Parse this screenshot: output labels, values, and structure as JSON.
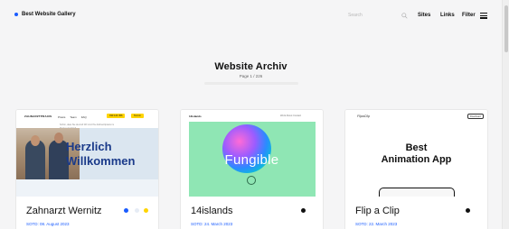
{
  "header": {
    "brand": "Best Website Gallery",
    "search_placeholder": "Search",
    "nav": [
      "Sites",
      "Links",
      "Filter"
    ]
  },
  "main": {
    "title": "Website Archiv",
    "pager": "Page 1 / 226"
  },
  "cards": [
    {
      "title": "Zahnarzt Wernitz",
      "date": "SOTD: 08. August 2023",
      "colors": [
        "#1a5cff",
        "#e6ecf5",
        "#ffd400"
      ],
      "thumb": {
        "logo": "ZAHNARZTPRAXIS",
        "menu": [
          "Praxis",
          "Team",
          "FAQ"
        ],
        "cta1": "030 123 456",
        "cta2": "Termin",
        "blurb": "Schön, dass Sie da sind! Wir sind Ihre Zahnarztpraxis im Herzen der Stadt.",
        "headline1": "Herzlich",
        "headline2": "Willkommen"
      }
    },
    {
      "title": "14islands",
      "date": "SOTD: 24. March 2023",
      "colors": [
        "#111111"
      ],
      "thumb": {
        "logo": "14islands",
        "topright": "Work  About  Contact",
        "headline": "Fungible"
      }
    },
    {
      "title": "Flip a Clip",
      "date": "SOTD: 22. March 2023",
      "colors": [
        "#111111"
      ],
      "thumb": {
        "logo": "FlipaClip",
        "button": "Download",
        "headline1": "Best",
        "headline2": "Animation App"
      }
    }
  ],
  "icons": [
    "search-icon",
    "menu-icon"
  ]
}
